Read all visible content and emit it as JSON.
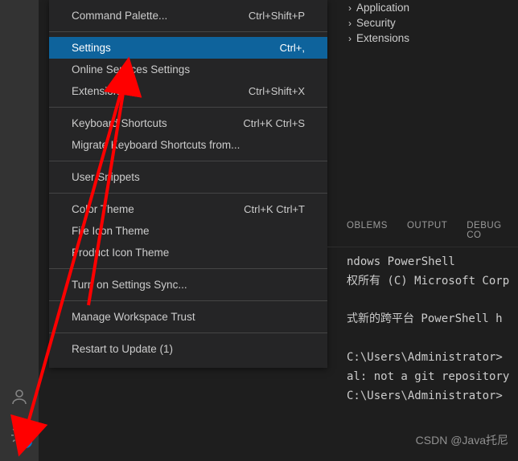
{
  "menu": {
    "commandPalette": {
      "label": "Command Palette...",
      "shortcut": "Ctrl+Shift+P"
    },
    "settings": {
      "label": "Settings",
      "shortcut": "Ctrl+,"
    },
    "onlineSettings": {
      "label": "Online Services Settings"
    },
    "extensions": {
      "label": "Extensions",
      "shortcut": "Ctrl+Shift+X"
    },
    "keyboardShortcuts": {
      "label": "Keyboard Shortcuts",
      "shortcut": "Ctrl+K Ctrl+S"
    },
    "migrateShortcuts": {
      "label": "Migrate Keyboard Shortcuts from..."
    },
    "userSnippets": {
      "label": "User Snippets"
    },
    "colorTheme": {
      "label": "Color Theme",
      "shortcut": "Ctrl+K Ctrl+T"
    },
    "fileIconTheme": {
      "label": "File Icon Theme"
    },
    "productIconTheme": {
      "label": "Product Icon Theme"
    },
    "settingsSync": {
      "label": "Turn on Settings Sync..."
    },
    "workspaceTrust": {
      "label": "Manage Workspace Trust"
    },
    "restart": {
      "label": "Restart to Update (1)"
    }
  },
  "tree": {
    "application": "Application",
    "security": "Security",
    "extensions": "Extensions"
  },
  "panel": {
    "problems": "OBLEMS",
    "output": "OUTPUT",
    "debug": "DEBUG CO"
  },
  "terminal": {
    "line1": "ndows PowerShell",
    "line2": "权所有 (C) Microsoft Corp",
    "line3": "式新的跨平台 PowerShell h",
    "line4": "C:\\Users\\Administrator>",
    "line5": "al: not a git repository",
    "line6": "C:\\Users\\Administrator>"
  },
  "badge": {
    "count": "1"
  },
  "watermark": "CSDN @Java托尼"
}
